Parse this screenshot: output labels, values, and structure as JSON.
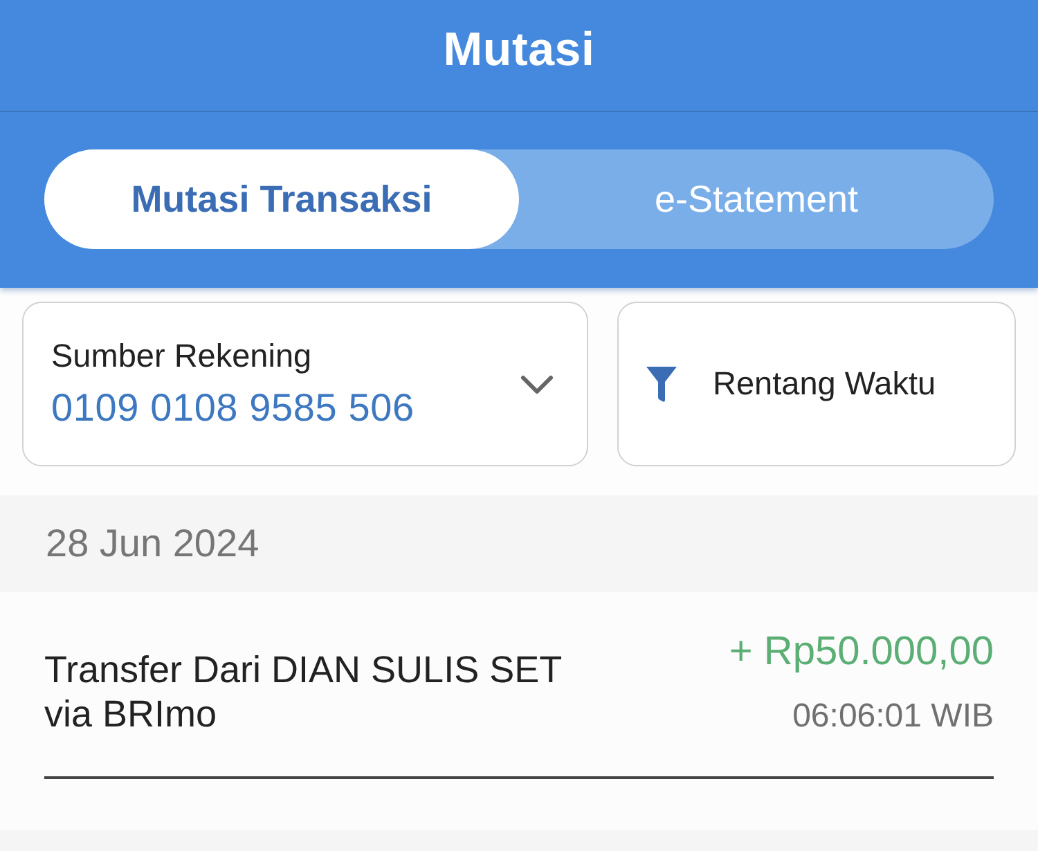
{
  "header": {
    "title": "Mutasi"
  },
  "tabs": [
    {
      "label": "Mutasi Transaksi",
      "selected": true
    },
    {
      "label": "e-Statement",
      "selected": false
    }
  ],
  "filters": {
    "account": {
      "label": "Sumber Rekening",
      "value": "0109 0108 9585 506"
    },
    "date_range": {
      "label": "Rentang Waktu"
    }
  },
  "groups": [
    {
      "date": "28 Jun 2024",
      "transactions": [
        {
          "description": "Transfer Dari DIAN SULIS SET via BRImo",
          "amount": "+ Rp50.000,00",
          "time": "06:06:01 WIB",
          "kind": "credit"
        }
      ]
    }
  ]
}
